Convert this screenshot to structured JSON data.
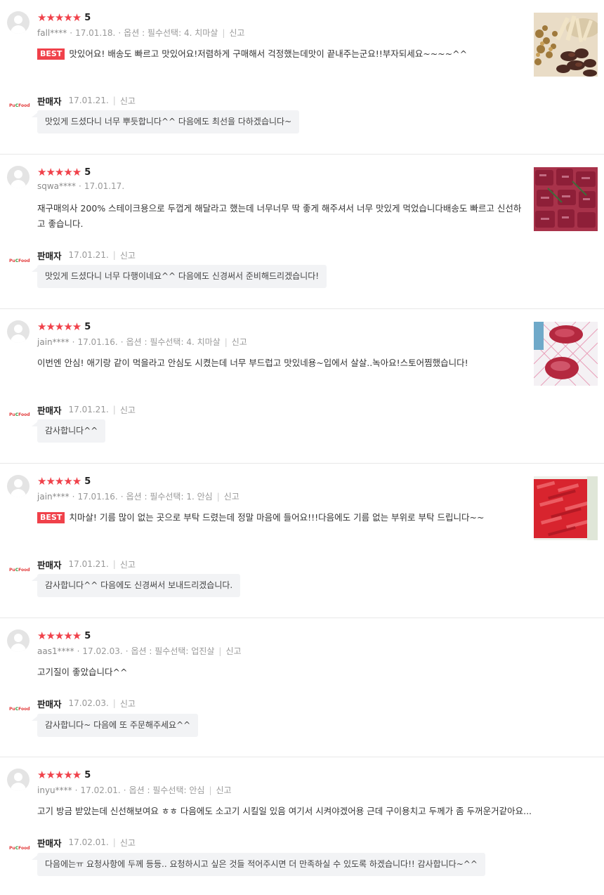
{
  "reviews": [
    {
      "rating_stars": "★★★★★",
      "rating": "5",
      "user": "fall****",
      "date": "17.01.18.",
      "option": "옵션 : 필수선택: 4. 치마살",
      "report": "신고",
      "best": "BEST",
      "text": "맛있어요! 배송도 빠르고 맛있어요!저렴하게 구매해서 걱정했는데맛이 끝내주는군요!!부자되세요~~~~^^",
      "photo": "fried-meat-photo",
      "seller": {
        "name": "판매자",
        "date": "17.01.21.",
        "report": "신고",
        "reply": "맛있게 드셨다니 너무 뿌듯합니다^^ 다음에도 최선을 다하겠습니다~"
      }
    },
    {
      "rating_stars": "★★★★★",
      "rating": "5",
      "user": "sqwa****",
      "date": "17.01.17.",
      "option": "",
      "report": "",
      "best": "",
      "text": "재구매의사 200% 스테이크용으로 두껍게 해달라고 했는데 너무너무 딱 좋게 해주셔서 너무 맛있게 먹었습니다배송도 빠르고 신선하고 좋습니다.",
      "photo": "raw-steak-cubes-photo",
      "seller": {
        "name": "판매자",
        "date": "17.01.21.",
        "report": "신고",
        "reply": "맛있게 드셨다니 너무 다행이네요^^ 다음에도 신경써서 준비해드리겠습니다!"
      }
    },
    {
      "rating_stars": "★★★★★",
      "rating": "5",
      "user": "jain****",
      "date": "17.01.16.",
      "option": "옵션 : 필수선택: 4. 치마살",
      "report": "신고",
      "best": "",
      "text": "이번엔 안심! 애기랑 같이 먹을라고 안심도 시켰는데 너무 부드럽고 맛있네용~입에서 살살..녹아요!스토어찜했습니다!",
      "photo": "steak-on-paper-photo",
      "seller": {
        "name": "판매자",
        "date": "17.01.21.",
        "report": "신고",
        "reply": "감사합니다^^"
      }
    },
    {
      "rating_stars": "★★★★★",
      "rating": "5",
      "user": "jain****",
      "date": "17.01.16.",
      "option": "옵션 : 필수선택: 1. 안심",
      "report": "신고",
      "best": "BEST",
      "text": "치마살! 기름 많이 없는 곳으로 부탁 드렸는데 정말 마음에 들어요!!!다음에도 기름 없는 부위로 부탁 드립니다~~",
      "photo": "sliced-beef-photo",
      "seller": {
        "name": "판매자",
        "date": "17.01.21.",
        "report": "신고",
        "reply": "감사합니다^^ 다음에도 신경써서 보내드리겠습니다."
      }
    },
    {
      "rating_stars": "★★★★★",
      "rating": "5",
      "user": "aas1****",
      "date": "17.02.03.",
      "option": "옵션 : 필수선택: 업진살",
      "report": "신고",
      "best": "",
      "text": "고기질이 좋았습니다^^",
      "photo": "",
      "seller": {
        "name": "판매자",
        "date": "17.02.03.",
        "report": "신고",
        "reply": "감사합니다~ 다음에 또 주문해주세요^^"
      }
    },
    {
      "rating_stars": "★★★★★",
      "rating": "5",
      "user": "inyu****",
      "date": "17.02.01.",
      "option": "옵션 : 필수선택: 안심",
      "report": "신고",
      "best": "",
      "text": "고기 방금 받았는데 신선해보여요 ㅎㅎ 다음에도 소고기 시킬일 있음 여기서 시켜야겠어용  근데 구이용치고 두께가 좀 두꺼운거같아요...",
      "photo": "",
      "seller": {
        "name": "판매자",
        "date": "17.02.01.",
        "report": "신고",
        "reply": "다음에는ㅠ 요청사항에 두께 등등.. 요청하시고 싶은 것들 적어주시면 더 만족하실 수 있도록 하겠습니다!! 감사합니다~^^"
      }
    }
  ],
  "seller_logo": {
    "p": "P",
    "rest": "u",
    "mark": "C",
    "tail": "Food"
  },
  "colors": {
    "star": "#f0414a",
    "best_badge": "#f0414a",
    "bubble_bg": "#f2f3f5",
    "avatar": "#e4e4e4"
  }
}
